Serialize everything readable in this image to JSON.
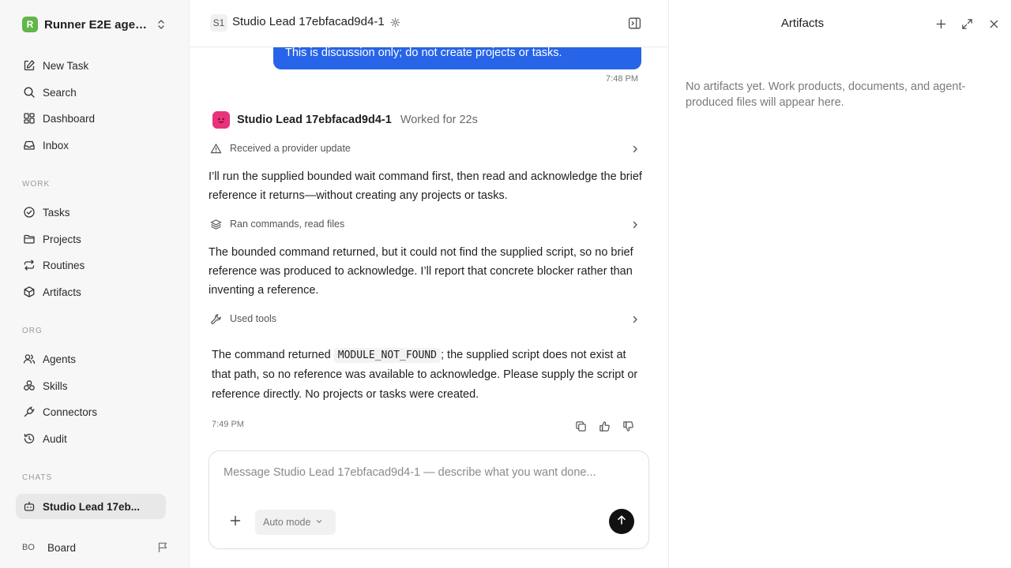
{
  "sidebar": {
    "workspace": {
      "logo_letter": "R",
      "name": "Runner E2E agen..."
    },
    "nav_primary": [
      {
        "label": "New Task",
        "icon": "edit-icon"
      },
      {
        "label": "Search",
        "icon": "search-icon"
      },
      {
        "label": "Dashboard",
        "icon": "dashboard-icon"
      },
      {
        "label": "Inbox",
        "icon": "inbox-icon"
      }
    ],
    "section_work": "WORK",
    "nav_work": [
      {
        "label": "Tasks",
        "icon": "check-circle-icon"
      },
      {
        "label": "Projects",
        "icon": "folder-icon"
      },
      {
        "label": "Routines",
        "icon": "repeat-icon"
      },
      {
        "label": "Artifacts",
        "icon": "cube-icon"
      }
    ],
    "section_org": "ORG",
    "nav_org": [
      {
        "label": "Agents",
        "icon": "users-icon"
      },
      {
        "label": "Skills",
        "icon": "skills-icon"
      },
      {
        "label": "Connectors",
        "icon": "plug-icon"
      },
      {
        "label": "Audit",
        "icon": "history-icon"
      }
    ],
    "section_chats": "CHATS",
    "chats": [
      {
        "label": "Studio Lead 17eb...",
        "icon": "bot-icon",
        "active": true
      }
    ],
    "board": {
      "badge": "BO",
      "label": "Board"
    }
  },
  "header": {
    "badge": "S1",
    "title": "Studio Lead 17ebfacad9d4-1"
  },
  "chat": {
    "user_message": "This is discussion only; do not create projects or tasks.",
    "user_time": "7:48 PM",
    "agent_name": "Studio Lead 17ebfacad9d4-1",
    "agent_status": "Worked for 22s",
    "step_1": "Received a provider update",
    "message_1": "I’ll run the supplied bounded wait command first, then read and acknowledge the brief reference it returns—without creating any projects or tasks.",
    "step_2": "Ran commands, read files",
    "message_2": "The bounded command returned, but it could not find the supplied script, so no brief reference was produced to acknowledge. I’ll report that concrete blocker rather than inventing a reference.",
    "step_3": "Used tools",
    "final_before": "The command returned ",
    "final_code": "MODULE_NOT_FOUND",
    "final_after": "; the supplied script does not exist at that path, so no reference was available to acknowledge. Please supply the script or reference directly. No projects or tasks were created.",
    "final_time": "7:49 PM"
  },
  "composer": {
    "placeholder": "Message Studio Lead 17ebfacad9d4-1 — describe what you want done...",
    "mode_label": "Auto mode"
  },
  "artifacts": {
    "title": "Artifacts",
    "empty_text": "No artifacts yet. Work products, documents, and agent-produced files will appear here."
  },
  "colors": {
    "accent": "#2764e8",
    "workspace_logo": "#62b64a",
    "agent_avatar": "#e8327a",
    "send_button": "#111111"
  }
}
